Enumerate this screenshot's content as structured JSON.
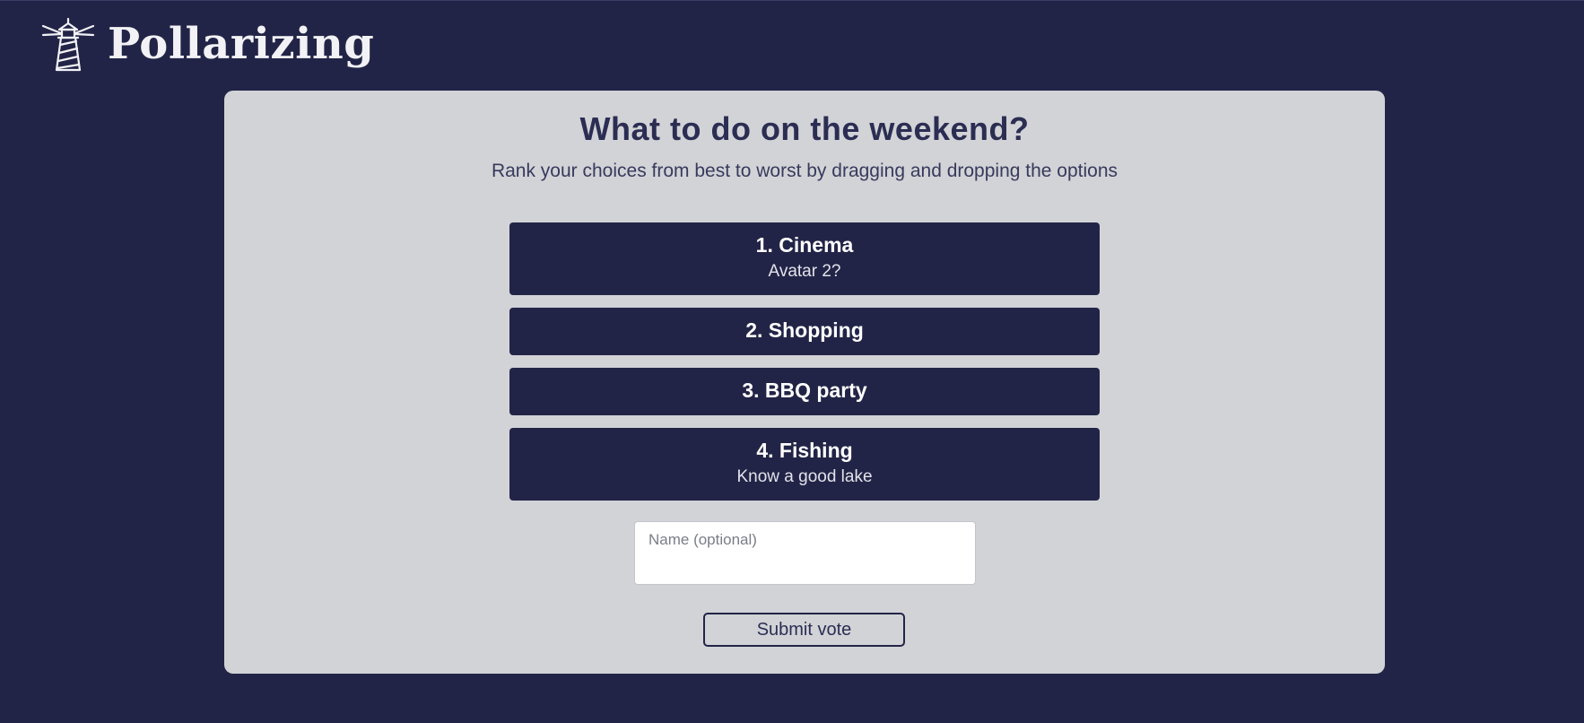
{
  "app": {
    "name": "Pollarizing",
    "logo_icon": "lighthouse-icon"
  },
  "poll": {
    "title": "What to do on the weekend?",
    "instructions": "Rank your choices from best to worst by dragging and dropping the options",
    "options": [
      {
        "label": "1. Cinema",
        "description": "Avatar 2?"
      },
      {
        "label": "2. Shopping",
        "description": ""
      },
      {
        "label": "3. BBQ party",
        "description": ""
      },
      {
        "label": "4. Fishing",
        "description": "Know a good lake"
      }
    ]
  },
  "form": {
    "name_placeholder": "Name (optional)",
    "name_value": "",
    "submit_label": "Submit vote"
  },
  "colors": {
    "background": "#222447",
    "card": "#d2d3d7",
    "option_bg": "#222447",
    "text_dark": "#2b2d52",
    "text_light": "#ffffff"
  }
}
